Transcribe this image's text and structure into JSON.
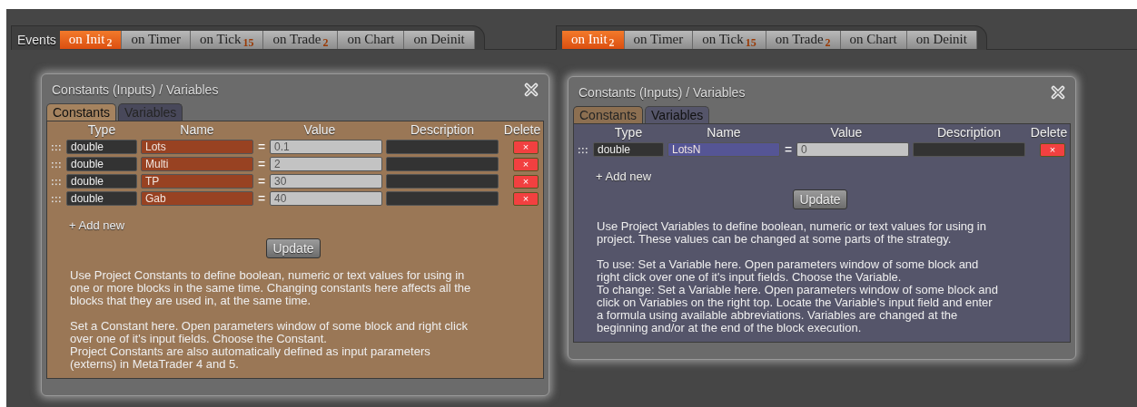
{
  "panels": [
    {
      "label": "Events",
      "tabs": [
        {
          "label": "on Init",
          "count": "2",
          "selected": true
        },
        {
          "label": "on Timer",
          "selected": false
        },
        {
          "label": "on Tick",
          "count": "15",
          "selected": false
        },
        {
          "label": "on Trade",
          "count": "2",
          "selected": false
        },
        {
          "label": "on Chart",
          "selected": false
        },
        {
          "label": "on Deinit",
          "selected": false
        }
      ],
      "dialog": {
        "title": "Constants (Inputs) / Variables",
        "subtabs": [
          {
            "label": "Constants",
            "selected": true
          },
          {
            "label": "Variables",
            "selected": false
          }
        ],
        "columns": [
          "Type",
          "Name",
          "Value",
          "Description",
          "Delete"
        ],
        "rows": [
          {
            "type": "double",
            "name": "Lots",
            "equals": "=",
            "value": "0.1",
            "delete": "×"
          },
          {
            "type": "double",
            "name": "Multi",
            "equals": "=",
            "value": "2",
            "delete": "×"
          },
          {
            "type": "double",
            "name": "TP",
            "equals": "=",
            "value": "30",
            "delete": "×"
          },
          {
            "type": "double",
            "name": "Gab",
            "equals": "=",
            "value": "40",
            "delete": "×"
          }
        ],
        "add_new": "+ Add new",
        "update": "Update",
        "paragraph_groups": [
          [
            "Use Project Constants to define boolean, numeric or text values for using in\none or more blocks in the same time. Changing constants here affects all the\nblocks that they are used in, at the same time."
          ],
          [
            "Set a Constant here. Open parameters window of some block and right click\nover one of it's input fields. Choose the Constant.",
            "Project Constants are also automatically defined as input parameters\n(externs) in MetaTrader 4 and 5."
          ]
        ]
      }
    },
    {
      "tabs": [
        {
          "label": "on Init",
          "count": "2",
          "selected": true
        },
        {
          "label": "on Timer",
          "selected": false
        },
        {
          "label": "on Tick",
          "count": "15",
          "selected": false
        },
        {
          "label": "on Trade",
          "count": "2",
          "selected": false
        },
        {
          "label": "on Chart",
          "selected": false
        },
        {
          "label": "on Deinit",
          "selected": false
        }
      ],
      "dialog": {
        "title": "Constants (Inputs) / Variables",
        "subtabs": [
          {
            "label": "Constants",
            "selected": false
          },
          {
            "label": "Variables",
            "selected": true
          }
        ],
        "columns": [
          "Type",
          "Name",
          "Value",
          "Description",
          "Delete"
        ],
        "rows": [
          {
            "type": "double",
            "name": "LotsN",
            "equals": "=",
            "value": "0",
            "delete": "×"
          }
        ],
        "add_new": "+ Add new",
        "update": "Update",
        "paragraph_groups": [
          [
            "Use Project Variables to define boolean, numeric or text values for using in\nproject. These values can be changed at some parts of the strategy."
          ],
          [
            "To use: Set a Variable here. Open parameters window of some block and\nright click over one of it's input fields. Choose the Variable.",
            "To change: Set a Variable here. Open parameters window of some block and\nclick on Variables on the right top. Locate the Variable's input field and enter\na formula using available abbreviations. Variables are changed at the\nbeginning and/or at the end of the block execution."
          ]
        ]
      }
    }
  ]
}
